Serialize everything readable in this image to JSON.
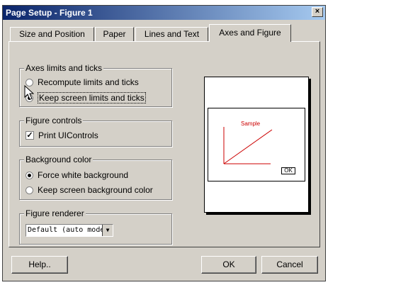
{
  "window": {
    "title": "Page Setup - Figure 1",
    "close_glyph": "×"
  },
  "tabs": [
    {
      "label": "Size and Position"
    },
    {
      "label": "Paper"
    },
    {
      "label": "Lines and Text"
    },
    {
      "label": "Axes and Figure"
    }
  ],
  "axes_limits": {
    "legend": "Axes limits and ticks",
    "options": [
      "Recompute limits and ticks",
      "Keep screen limits and ticks"
    ],
    "selected": "Keep screen limits and ticks"
  },
  "figure_controls": {
    "legend": "Figure controls",
    "print_uicontrols_label": "Print UIControls",
    "checked": true,
    "check_glyph": "✓"
  },
  "background_color": {
    "legend": "Background color",
    "options": [
      "Force white background",
      "Keep screen background color"
    ],
    "selected": "Force white background"
  },
  "figure_renderer": {
    "legend": "Figure renderer",
    "value": "Default (auto mode)",
    "arrow_glyph": "▼"
  },
  "preview": {
    "sample_text": "Sample",
    "ok_text": "OK",
    "line_color": "#cc0000"
  },
  "buttons": {
    "help": "Help..",
    "ok": "OK",
    "cancel": "Cancel"
  }
}
